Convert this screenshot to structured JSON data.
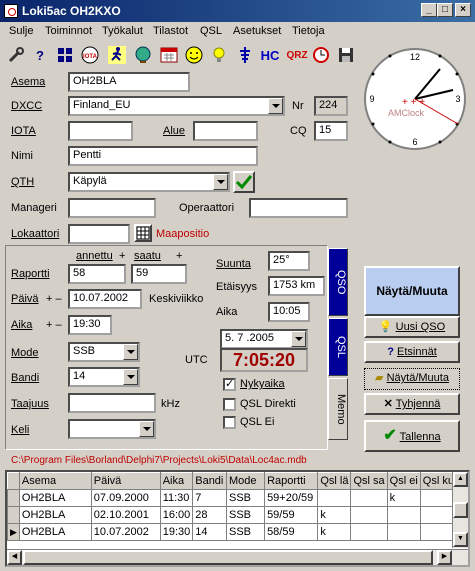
{
  "window": {
    "title": "Loki5ac OH2KXO"
  },
  "menu": [
    "Sulje",
    "Toiminnot",
    "Työkalut",
    "Tilastot",
    "QSL",
    "Asetukset",
    "Tietoja"
  ],
  "toolbar": {
    "hc": "HC",
    "qrz": "QRZ",
    "help": "?"
  },
  "form": {
    "asema_label": "Asema",
    "asema_value": "OH2BLA",
    "dxcc_label": "DXCC",
    "dxcc_value": "Finland_EU",
    "nr_label": "Nr",
    "nr_value": "224",
    "iota_label": "IOTA",
    "iota_value": "",
    "alue_label": "Alue",
    "alue_value": "",
    "cq_label": "CQ",
    "cq_value": "15",
    "nimi_label": "Nimi",
    "nimi_value": "Pentti",
    "qth_label": "QTH",
    "qth_value": "Käpylä",
    "manageri_label": "Manageri",
    "manageri_value": "",
    "operaattori_label": "Operaattori",
    "operaattori_value": "",
    "lokaattori_label": "Lokaattori",
    "lokaattori_value": "",
    "maapositio": "Maapositio"
  },
  "qso": {
    "annettu": "annettu",
    "saatu": "saatu",
    "plus": "+",
    "plusminus": "+ –",
    "raportti_label": "Raportti",
    "raportti_annettu": "58",
    "raportti_saatu": "59",
    "suunta_label": "Suunta",
    "suunta_value": "25°",
    "etaisyys_label": "Etäisyys",
    "etaisyys_value": "1753 km",
    "paiva_label": "Päivä",
    "paiva_value": "10.07.2002",
    "weekday": "Keskiviikko",
    "aika_label": "Aika",
    "aika_value": "19:30",
    "aika2_label": "Aika",
    "aika2_value": "10:05",
    "date_combo": "5. 7 .2005",
    "utc_label": "UTC",
    "utc_time": "7:05:20",
    "mode_label": "Mode",
    "mode_value": "SSB",
    "bandi_label": "Bandi",
    "bandi_value": "14",
    "taajuus_label": "Taajuus",
    "taajuus_value": "",
    "khz": "kHz",
    "keli_label": "Keli",
    "keli_value": "",
    "nykyaika": "Nykyaika",
    "qsl_direkti": "QSL Direkti",
    "qsl_ei": "QSL Ei",
    "tab_qso": "QSO",
    "tab_qsl": "QSL",
    "tab_memo": "Memo"
  },
  "clock": {
    "brand": "AMClock",
    "n12": "12",
    "n3": "3",
    "n6": "6",
    "n9": "9"
  },
  "buttons": {
    "nayta_muuta_big": "Näytä/Muuta",
    "uusi_qso": "Uusi QSO",
    "etsinnat": "Etsinnät",
    "nayta_muuta": "Näytä/Muuta",
    "tyhjenna": "Tyhjennä",
    "tallenna": "Tallenna"
  },
  "path": "C:\\Program Files\\Borland\\Delphi7\\Projects\\Loki5\\Data\\Loc4ac.mdb",
  "grid": {
    "headers": [
      "Asema",
      "Päivä",
      "Aika",
      "Bandi",
      "Mode",
      "Raportti",
      "Qsl lä",
      "Qsl sa",
      "Qsl ei",
      "Qsl ku"
    ],
    "rows": [
      [
        "OH2BLA",
        "07.09.2000",
        "11:30",
        "7",
        "SSB",
        "59+20/59",
        "",
        "",
        "k",
        ""
      ],
      [
        "OH2BLA",
        "02.10.2001",
        "16:00",
        "28",
        "SSB",
        "59/59",
        "k",
        "",
        "",
        ""
      ],
      [
        "OH2BLA",
        "10.07.2002",
        "19:30",
        "14",
        "SSB",
        "58/59",
        "k",
        "",
        "",
        ""
      ]
    ]
  },
  "colors": {
    "title_start": "#0a246a",
    "title_end": "#3a6ea5",
    "utc_red": "#a00000",
    "path_red": "#c00000",
    "tab_blue": "#000099"
  }
}
